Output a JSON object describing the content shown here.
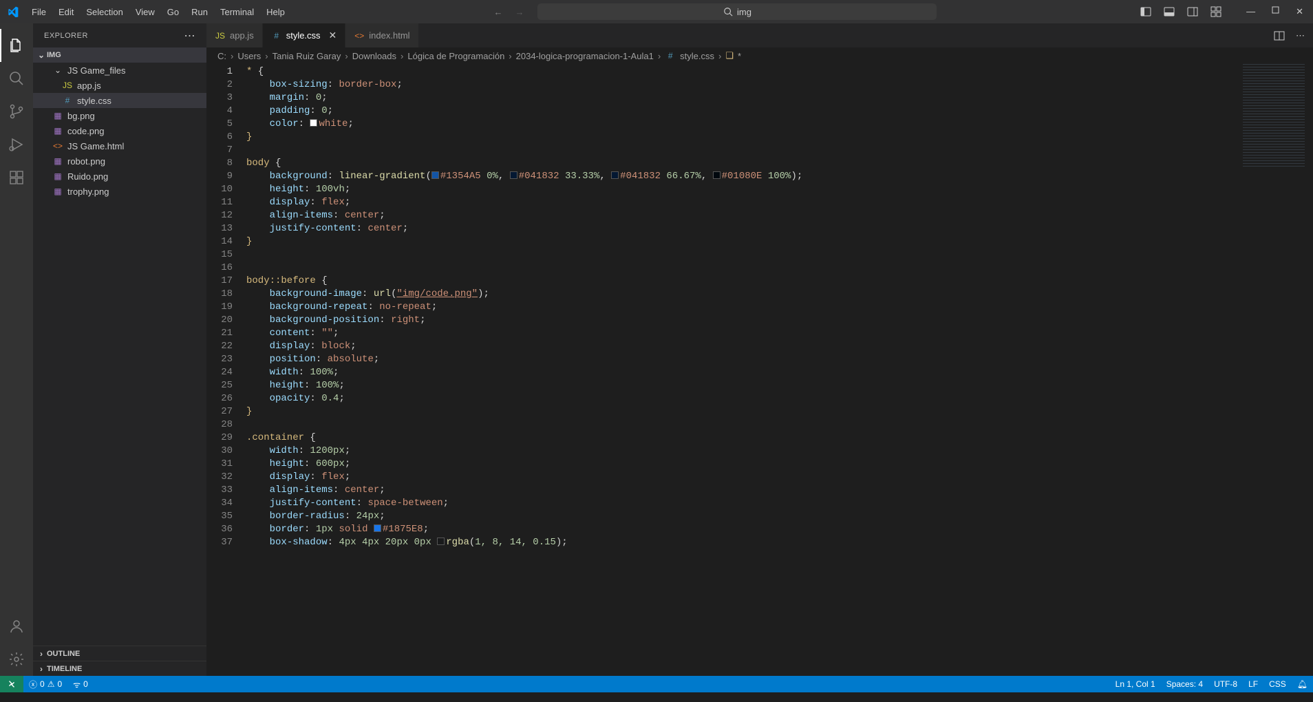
{
  "menu": [
    "File",
    "Edit",
    "Selection",
    "View",
    "Go",
    "Run",
    "Terminal",
    "Help"
  ],
  "search": {
    "text": "img"
  },
  "explorer": {
    "title": "EXPLORER"
  },
  "folder": {
    "name": "IMG"
  },
  "tree": {
    "folder1": "JS Game_files",
    "f_appjs": "app.js",
    "f_stylecss": "style.css",
    "f_bg": "bg.png",
    "f_code": "code.png",
    "f_game": "JS Game.html",
    "f_robot": "robot.png",
    "f_ruido": "Ruido.png",
    "f_trophy": "trophy.png"
  },
  "outline": "OUTLINE",
  "timeline": "TIMELINE",
  "tabs": {
    "t1": "app.js",
    "t2": "style.css",
    "t3": "index.html"
  },
  "breadcrumbs": {
    "c1": "C:",
    "c2": "Users",
    "c3": "Tania Ruiz Garay",
    "c4": "Downloads",
    "c5": "Lógica de Programación",
    "c6": "2034-logica-programacion-1-Aula1",
    "c7": "style.css",
    "c8": "*"
  },
  "lines": {
    "count": 37
  },
  "code": {
    "l1_sel": "*",
    "boxsizing": "box-sizing",
    "boxsizing_v": "border-box",
    "margin": "margin",
    "zero": "0",
    "padding": "padding",
    "color": "color",
    "white": "white",
    "body": "body",
    "background": "background",
    "lg": "linear-gradient",
    "c_1354": "#1354A5",
    "p0": "0%",
    "c_041832": "#041832",
    "p33": "33.33%",
    "p66": "66.67%",
    "c_01080e": "#01080E",
    "p100": "100%",
    "height": "height",
    "h100vh": "100vh",
    "display": "display",
    "flex": "flex",
    "align": "align-items",
    "center": "center",
    "justify": "justify-content",
    "before": "body::before",
    "bgimage": "background-image",
    "url": "url",
    "urlpath": "\"img/code.png\"",
    "bgrepeat": "background-repeat",
    "norepeat": "no-repeat",
    "bgpos": "background-position",
    "right": "right",
    "content": "content",
    "empty": "\"\"",
    "block": "block",
    "position": "position",
    "absolute": "absolute",
    "width": "width",
    "p100_2": "100%",
    "opacity": "opacity",
    "op04": "0.4",
    "container": ".container",
    "w1200": "1200px",
    "h600": "600px",
    "spacebtw": "space-between",
    "bradius": "border-radius",
    "r24": "24px",
    "border": "border",
    "b1px": "1px",
    "solid": "solid",
    "c_1875": "#1875E8",
    "boxshadow": "box-shadow",
    "sh": "4px 4px 20px 0px",
    "rgba": "rgba",
    "rgbav": "1, 8, 14, 0.15"
  },
  "status": {
    "errors": "0",
    "warnings": "0",
    "ports": "0",
    "lncol": "Ln 1, Col 1",
    "spaces": "Spaces: 4",
    "encoding": "UTF-8",
    "eol": "LF",
    "lang": "CSS"
  }
}
